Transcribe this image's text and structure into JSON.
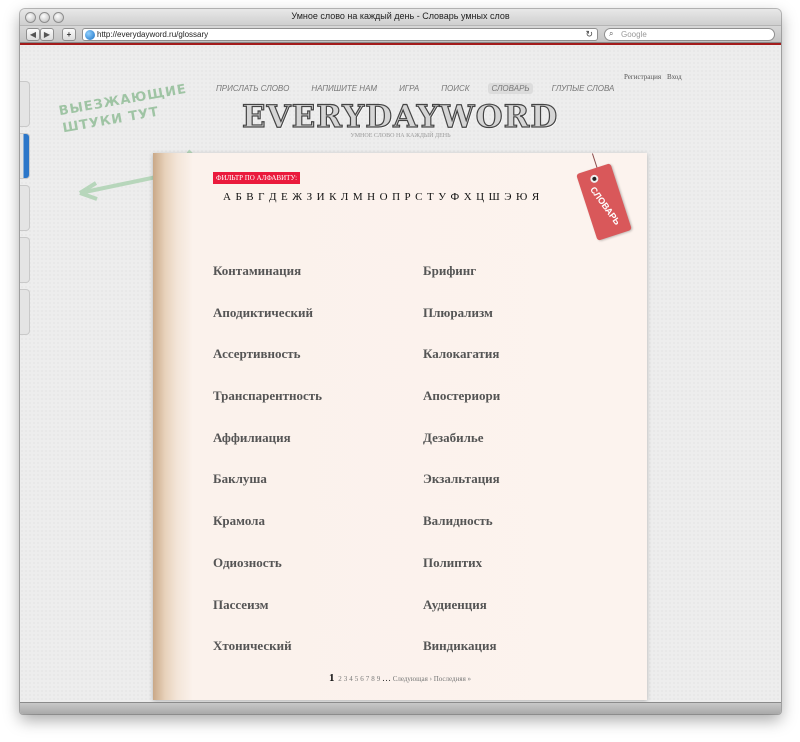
{
  "window": {
    "title": "Умное слово на каждый день - Словарь умных слов"
  },
  "toolbar": {
    "back_label": "◀",
    "forward_label": "▶",
    "add_label": "+",
    "url": "http://everydayword.ru/glossary",
    "reload_icon": "reload-icon",
    "search_placeholder": "Google"
  },
  "header": {
    "auth": {
      "register": "Регистрация",
      "login": "Вход"
    },
    "nav": [
      {
        "label": "ПРИСЛАТЬ СЛОВО"
      },
      {
        "label": "НАПИШИТЕ НАМ"
      },
      {
        "label": "ИГРА"
      },
      {
        "label": "ПОИСК"
      },
      {
        "label": "СЛОВАРЬ"
      },
      {
        "label": "ГЛУПЫЕ СЛОВА"
      }
    ],
    "logo": "EVERYDAYWORD",
    "tagline": "УМНОЕ СЛОВО НА КАЖДЫЙ ДЕНЬ"
  },
  "sticker": {
    "line1": "ВЫЕЗЖАЮЩИЕ",
    "line2": "ШТУКИ ТУТ"
  },
  "glossary": {
    "filter_label": "ФИЛЬТР ПО АЛФАВИТУ:",
    "letters": [
      "А",
      "Б",
      "В",
      "Г",
      "Д",
      "Е",
      "Ж",
      "З",
      "И",
      "К",
      "Л",
      "М",
      "Н",
      "О",
      "П",
      "Р",
      "С",
      "Т",
      "У",
      "Ф",
      "Х",
      "Ц",
      "Ш",
      "Э",
      "Ю",
      "Я"
    ],
    "tag_label": "СЛОВАРЬ",
    "rows": [
      [
        "Контаминация",
        "Брифинг"
      ],
      [
        "Аподиктический",
        "Плюрализм"
      ],
      [
        "Ассертивность",
        "Калокагатия"
      ],
      [
        "Транспарентность",
        "Апостериори"
      ],
      [
        "Аффилиация",
        "Дезабилье"
      ],
      [
        "Баклуша",
        "Экзальтация"
      ],
      [
        "Крамола",
        "Валидность"
      ],
      [
        "Одиозность",
        "Полиптих"
      ],
      [
        "Пассеизм",
        "Аудиенция"
      ],
      [
        "Хтонический",
        "Виндикация"
      ]
    ]
  },
  "pager": {
    "current": "1",
    "pages": [
      "2",
      "3",
      "4",
      "5",
      "6",
      "7",
      "8",
      "9"
    ],
    "ellipsis": "…",
    "next": "Следующая ›",
    "last": "Последняя »"
  },
  "colors": {
    "accent": "#ea1a3c",
    "browser_line": "#a31c1c",
    "tag": "#d9585a"
  }
}
